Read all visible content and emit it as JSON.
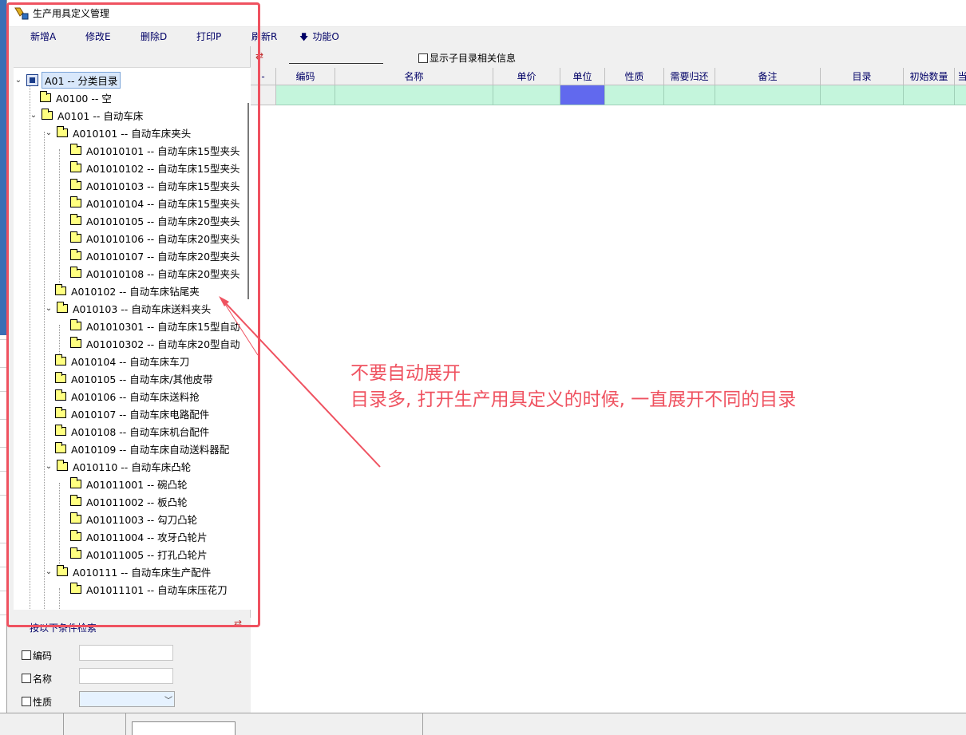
{
  "window": {
    "title": "生产用具定义管理"
  },
  "toolbar": {
    "add": "新增A",
    "edit": "修改E",
    "delete": "删除D",
    "print": "打印P",
    "refresh": "刷新R",
    "function": "功能O"
  },
  "tree": {
    "items": [
      {
        "label": "A01 -- 分类目录",
        "level": 0,
        "expanded": true,
        "root": true
      },
      {
        "label": "A0100 -- 空",
        "level": 1
      },
      {
        "label": "A0101 -- 自动车床",
        "level": 1,
        "expanded": true
      },
      {
        "label": "A010101 -- 自动车床夹头",
        "level": 2,
        "expanded": true
      },
      {
        "label": "A01010101 -- 自动车床15型夹头",
        "level": 3
      },
      {
        "label": "A01010102 -- 自动车床15型夹头",
        "level": 3
      },
      {
        "label": "A01010103 -- 自动车床15型夹头",
        "level": 3
      },
      {
        "label": "A01010104 -- 自动车床15型夹头",
        "level": 3
      },
      {
        "label": "A01010105 -- 自动车床20型夹头",
        "level": 3
      },
      {
        "label": "A01010106 -- 自动车床20型夹头",
        "level": 3
      },
      {
        "label": "A01010107 -- 自动车床20型夹头",
        "level": 3
      },
      {
        "label": "A01010108 -- 自动车床20型夹头",
        "level": 3
      },
      {
        "label": "A010102 -- 自动车床钻尾夹",
        "level": 2
      },
      {
        "label": "A010103 -- 自动车床送料夹头",
        "level": 2,
        "expanded": true
      },
      {
        "label": "A01010301 -- 自动车床15型自动",
        "level": 3
      },
      {
        "label": "A01010302 -- 自动车床20型自动",
        "level": 3
      },
      {
        "label": "A010104 -- 自动车床车刀",
        "level": 2
      },
      {
        "label": "A010105 -- 自动车床/其他皮带",
        "level": 2
      },
      {
        "label": "A010106 -- 自动车床送料抢",
        "level": 2
      },
      {
        "label": "A010107 -- 自动车床电路配件",
        "level": 2
      },
      {
        "label": "A010108 -- 自动车床机台配件",
        "level": 2
      },
      {
        "label": "A010109 -- 自动车床自动送料器配",
        "level": 2
      },
      {
        "label": "A010110 -- 自动车床凸轮",
        "level": 2,
        "expanded": true
      },
      {
        "label": "A01011001 -- 碗凸轮",
        "level": 3
      },
      {
        "label": "A01011002 -- 板凸轮",
        "level": 3
      },
      {
        "label": "A01011003 -- 勾刀凸轮",
        "level": 3
      },
      {
        "label": "A01011004 -- 攻牙凸轮片",
        "level": 3
      },
      {
        "label": "A01011005 -- 打孔凸轮片",
        "level": 3
      },
      {
        "label": "A010111 -- 自动车床生产配件",
        "level": 2,
        "expanded": true
      },
      {
        "label": "A01011101 -- 自动车床压花刀",
        "level": 3
      }
    ]
  },
  "search": {
    "title": "按以下条件检索",
    "code_label": "编码",
    "name_label": "名称",
    "nature_label": "性质"
  },
  "grid": {
    "show_sub_label": "显示子目录相关信息",
    "columns": [
      "编码",
      "名称",
      "单价",
      "单位",
      "性质",
      "需要归还",
      "备注",
      "目录",
      "初始数量",
      "当"
    ],
    "row_indicator": "I"
  },
  "annotation": {
    "line1": "不要自动展开",
    "line2": "目录多, 打开生产用具定义的时候, 一直展开不同的目录",
    "color": "#ef5260"
  }
}
